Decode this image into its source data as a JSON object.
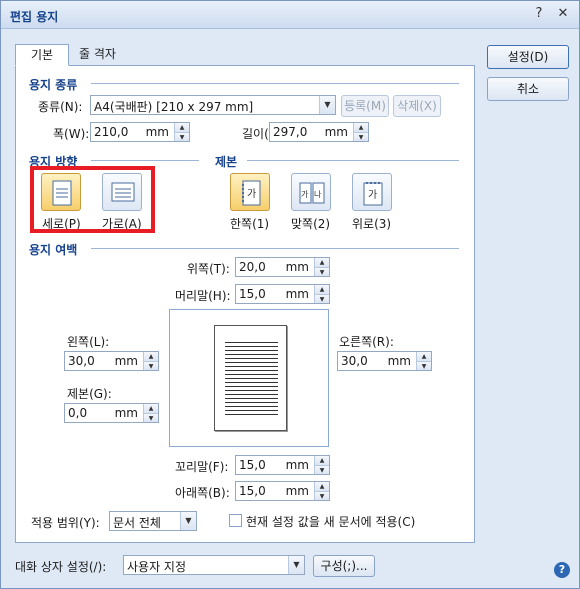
{
  "window": {
    "title": "편집 용지",
    "help_glyph": "?",
    "close_glyph": "✕"
  },
  "tabs": {
    "basic": "기본",
    "grid": "줄 격자"
  },
  "paper_type": {
    "section": "용지 종류",
    "type_label": "종류(N):",
    "type_value": "A4(국배판)  [210 x 297 mm]",
    "register_btn": "등록(M)",
    "delete_btn": "삭제(X)",
    "width_label": "폭(W):",
    "width_value": "210,0",
    "length_label": "길이(E):",
    "length_value": "297,0",
    "unit": "mm"
  },
  "orientation": {
    "section": "용지 방향",
    "portrait": "세로(P)",
    "landscape": "가로(A)"
  },
  "binding": {
    "section": "제본",
    "one_side": "한쪽(1)",
    "facing": "맞쪽(2)",
    "top": "위로(3)"
  },
  "margins": {
    "section": "용지 여백",
    "top_label": "위쪽(T):",
    "top_value": "20,0",
    "header_label": "머리말(H):",
    "header_value": "15,0",
    "left_label": "왼쪽(L):",
    "left_value": "30,0",
    "right_label": "오른쪽(R):",
    "right_value": "30,0",
    "gutter_label": "제본(G):",
    "gutter_value": "0,0",
    "footer_label": "꼬리말(F):",
    "footer_value": "15,0",
    "bottom_label": "아래쪽(B):",
    "bottom_value": "15,0",
    "unit": "mm"
  },
  "apply": {
    "scope_label": "적용 범위(Y):",
    "scope_value": "문서 전체",
    "new_doc_checkbox": "현재 설정 값을 새 문서에 적용(C)"
  },
  "buttons": {
    "ok": "설정(D)",
    "cancel": "취소"
  },
  "footer": {
    "dialog_setting_label": "대화 상자 설정(/):",
    "dialog_setting_value": "사용자 지정",
    "configure_btn": "구성(;)...",
    "help_glyph": "?"
  }
}
